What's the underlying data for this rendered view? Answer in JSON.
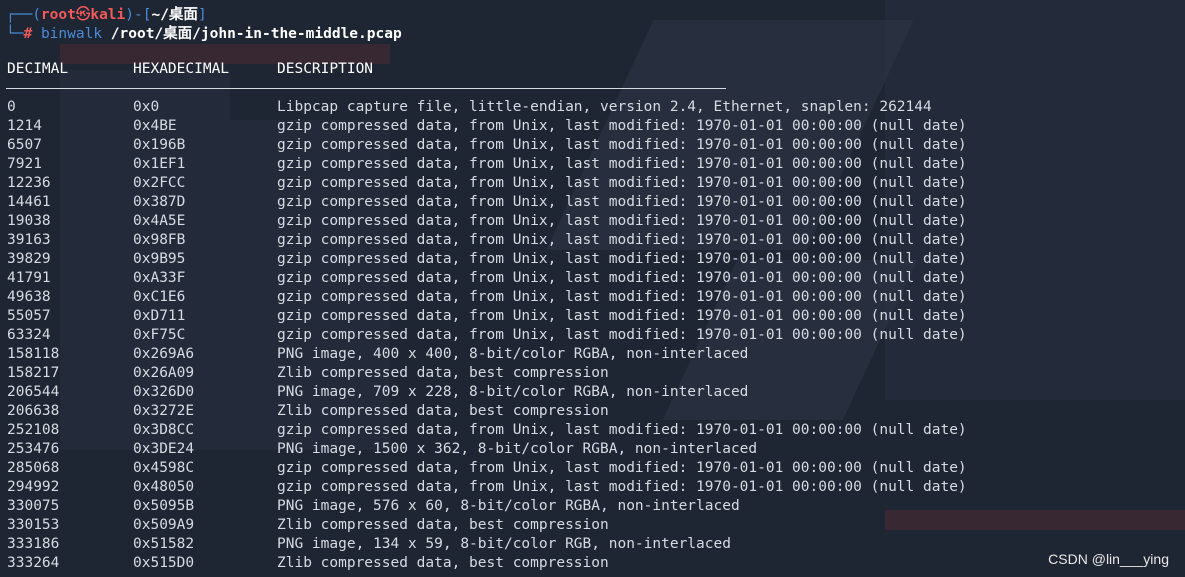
{
  "prompt": {
    "user": "root",
    "skull": "㉿",
    "host": "kali",
    "cwd": "~/桌面",
    "hash": "#",
    "command": "binwalk",
    "argument": "/root/桌面/john-in-the-middle.pcap"
  },
  "columns": {
    "decimal": "DECIMAL",
    "hexadecimal": "HEXADECIMAL",
    "description": "DESCRIPTION"
  },
  "rows": [
    {
      "dec": "0",
      "hex": "0x0",
      "desc": "Libpcap capture file, little-endian, version 2.4, Ethernet, snaplen: 262144"
    },
    {
      "dec": "1214",
      "hex": "0x4BE",
      "desc": "gzip compressed data, from Unix, last modified: 1970-01-01 00:00:00 (null date)"
    },
    {
      "dec": "6507",
      "hex": "0x196B",
      "desc": "gzip compressed data, from Unix, last modified: 1970-01-01 00:00:00 (null date)"
    },
    {
      "dec": "7921",
      "hex": "0x1EF1",
      "desc": "gzip compressed data, from Unix, last modified: 1970-01-01 00:00:00 (null date)"
    },
    {
      "dec": "12236",
      "hex": "0x2FCC",
      "desc": "gzip compressed data, from Unix, last modified: 1970-01-01 00:00:00 (null date)"
    },
    {
      "dec": "14461",
      "hex": "0x387D",
      "desc": "gzip compressed data, from Unix, last modified: 1970-01-01 00:00:00 (null date)"
    },
    {
      "dec": "19038",
      "hex": "0x4A5E",
      "desc": "gzip compressed data, from Unix, last modified: 1970-01-01 00:00:00 (null date)"
    },
    {
      "dec": "39163",
      "hex": "0x98FB",
      "desc": "gzip compressed data, from Unix, last modified: 1970-01-01 00:00:00 (null date)"
    },
    {
      "dec": "39829",
      "hex": "0x9B95",
      "desc": "gzip compressed data, from Unix, last modified: 1970-01-01 00:00:00 (null date)"
    },
    {
      "dec": "41791",
      "hex": "0xA33F",
      "desc": "gzip compressed data, from Unix, last modified: 1970-01-01 00:00:00 (null date)"
    },
    {
      "dec": "49638",
      "hex": "0xC1E6",
      "desc": "gzip compressed data, from Unix, last modified: 1970-01-01 00:00:00 (null date)"
    },
    {
      "dec": "55057",
      "hex": "0xD711",
      "desc": "gzip compressed data, from Unix, last modified: 1970-01-01 00:00:00 (null date)"
    },
    {
      "dec": "63324",
      "hex": "0xF75C",
      "desc": "gzip compressed data, from Unix, last modified: 1970-01-01 00:00:00 (null date)"
    },
    {
      "dec": "158118",
      "hex": "0x269A6",
      "desc": "PNG image, 400 x 400, 8-bit/color RGBA, non-interlaced"
    },
    {
      "dec": "158217",
      "hex": "0x26A09",
      "desc": "Zlib compressed data, best compression"
    },
    {
      "dec": "206544",
      "hex": "0x326D0",
      "desc": "PNG image, 709 x 228, 8-bit/color RGBA, non-interlaced"
    },
    {
      "dec": "206638",
      "hex": "0x3272E",
      "desc": "Zlib compressed data, best compression"
    },
    {
      "dec": "252108",
      "hex": "0x3D8CC",
      "desc": "gzip compressed data, from Unix, last modified: 1970-01-01 00:00:00 (null date)"
    },
    {
      "dec": "253476",
      "hex": "0x3DE24",
      "desc": "PNG image, 1500 x 362, 8-bit/color RGBA, non-interlaced"
    },
    {
      "dec": "285068",
      "hex": "0x4598C",
      "desc": "gzip compressed data, from Unix, last modified: 1970-01-01 00:00:00 (null date)"
    },
    {
      "dec": "294992",
      "hex": "0x48050",
      "desc": "gzip compressed data, from Unix, last modified: 1970-01-01 00:00:00 (null date)"
    },
    {
      "dec": "330075",
      "hex": "0x5095B",
      "desc": "PNG image, 576 x 60, 8-bit/color RGBA, non-interlaced"
    },
    {
      "dec": "330153",
      "hex": "0x509A9",
      "desc": "Zlib compressed data, best compression"
    },
    {
      "dec": "333186",
      "hex": "0x51582",
      "desc": "PNG image, 134 x 59, 8-bit/color RGB, non-interlaced"
    },
    {
      "dec": "333264",
      "hex": "0x515D0",
      "desc": "Zlib compressed data, best compression"
    }
  ],
  "watermark": "CSDN @lin___ying"
}
